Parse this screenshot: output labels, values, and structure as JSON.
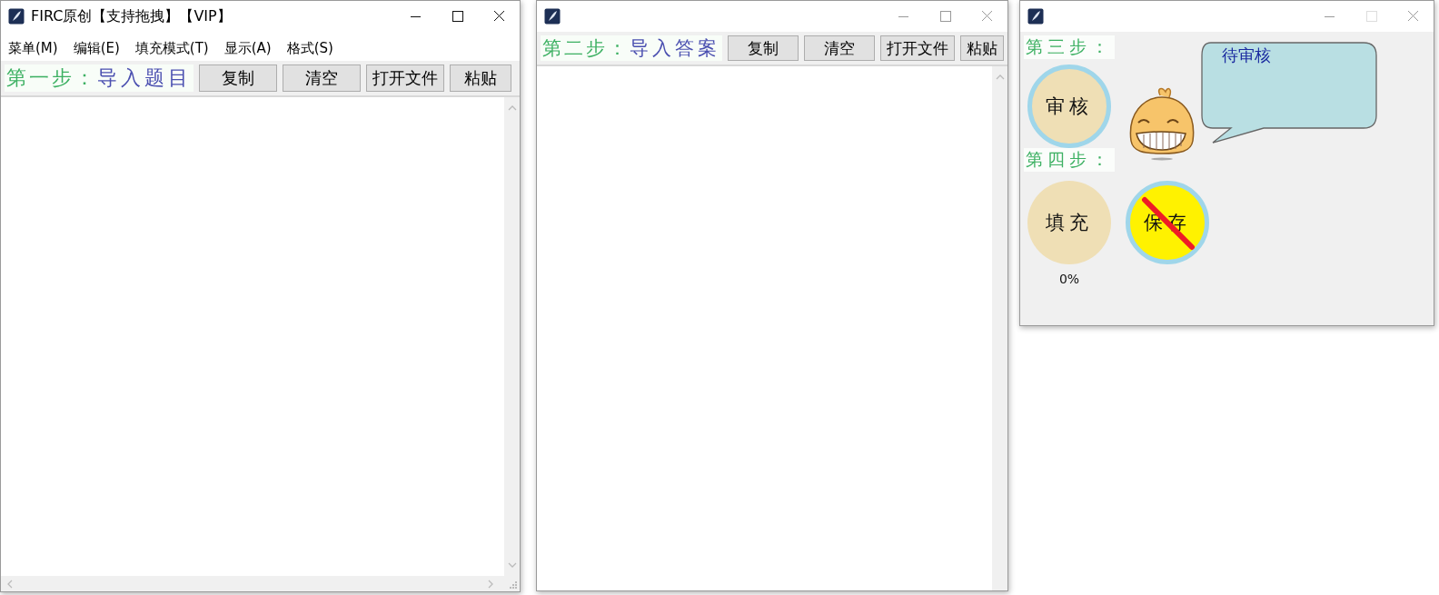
{
  "windows": [
    {
      "kind": "editor",
      "active": true,
      "title": "FIRC原创【支持拖拽】【VIP】",
      "maximize_disabled": false,
      "menu": [
        "菜单(M)",
        "编辑(E)",
        "填充模式(T)",
        "显示(A)",
        "格式(S)"
      ],
      "step": "第一步：",
      "heading": "导入题目",
      "buttons": [
        "复制",
        "清空",
        "打开文件",
        "粘贴"
      ],
      "horizontal_scrollbar": true
    },
    {
      "kind": "editor",
      "active": false,
      "maximize_disabled": false,
      "step": "第二步：",
      "heading": "导入答案",
      "buttons": [
        "复制",
        "清空",
        "打开文件",
        "粘贴"
      ],
      "horizontal_scrollbar": false
    },
    {
      "kind": "control",
      "active": false,
      "maximize_disabled": true,
      "review_step": "第三步：",
      "review_button": {
        "label": "审核",
        "ringed": true,
        "disabled": false
      },
      "bubble": "待审核",
      "fill_step": "第四步：",
      "actions": [
        {
          "label": "填充",
          "ringed": false,
          "disabled": false,
          "progress": "0%"
        },
        {
          "label": "保存",
          "ringed": true,
          "disabled": true
        }
      ]
    }
  ]
}
